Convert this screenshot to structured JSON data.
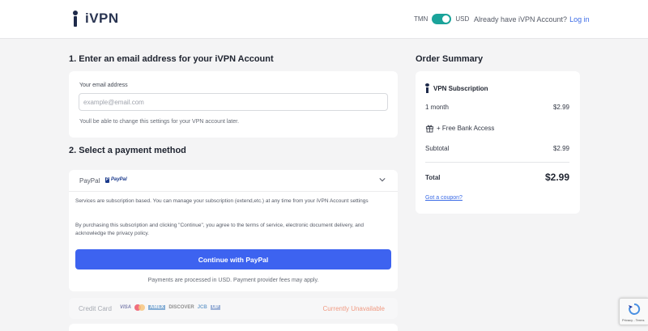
{
  "header": {
    "brand": "iVPN",
    "currency_left": "TMN",
    "currency_right": "USD",
    "account_prompt": "Already have iVPN Account?",
    "login_label": "Log in"
  },
  "email_section": {
    "title": "1. Enter an email address for your iVPN Account",
    "field_label": "Your email address",
    "placeholder": "example@email.com",
    "value": "",
    "note": "Youll be able to change this settings for your VPN account later."
  },
  "payment_section": {
    "title": "2. Select a payment method",
    "paypal": {
      "label": "PayPal",
      "logo_text": "PayPal",
      "info_1": "Services are subscription based. You can manage your subscription (extend,etc.) at any time from your iVPN Account settings",
      "info_2": "By purchasing this subscription and clicking \"Continue\", you agree to the terms of service, electronic document delivery, and acknowledge the privacy policy.",
      "button": "Continue with PayPal",
      "footnote": "Payments are processed in USD. Payment provider fees may apply."
    },
    "credit_card": {
      "label": "Credit Card",
      "brands": [
        "VISA",
        "mastercard",
        "AMEX",
        "DISCOVER",
        "JCB",
        "UnionPay"
      ],
      "status": "Currently Unavailable"
    }
  },
  "summary": {
    "title": "Order Summary",
    "product": "VPN Subscription",
    "rows": [
      {
        "label": "1 month",
        "value": "$2.99"
      },
      {
        "label": "+ Free Bank Access",
        "value": ""
      },
      {
        "label": "Subtotal",
        "value": "$2.99"
      }
    ],
    "total_label": "Total",
    "total_value": "$2.99",
    "coupon": "Got a coupon?"
  },
  "recaptcha": {
    "text": "Privacy - Terms"
  },
  "colors": {
    "accent": "#3d63f0",
    "toggle": "#1aa39a",
    "link": "#3b6be6",
    "unavailable": "#f09a82"
  }
}
